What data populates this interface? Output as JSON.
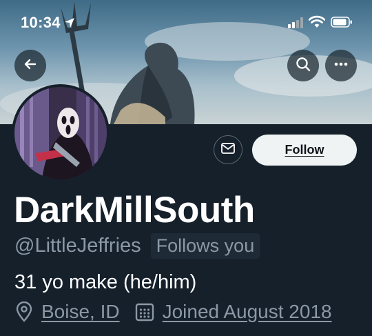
{
  "status_bar": {
    "time": "10:34",
    "location_icon": "location-arrow-icon",
    "signal_icon": "cellular-signal-icon",
    "wifi_icon": "wifi-icon",
    "battery_icon": "battery-icon"
  },
  "header": {
    "back_icon": "back-arrow-icon",
    "search_icon": "search-icon",
    "more_icon": "more-dots-icon"
  },
  "profile": {
    "display_name": "DarkMillSouth",
    "handle": "@LittleJeffries",
    "follows_you": "Follows you",
    "bio": "31 yo make (he/him)",
    "location": "Boise, ID",
    "joined": "Joined August 2018"
  },
  "actions": {
    "message_icon": "envelope-icon",
    "follow_label": "Follow"
  },
  "colors": {
    "background": "#15202b",
    "secondary_text": "#8b98a5",
    "follow_button_bg": "#eff3f4"
  }
}
